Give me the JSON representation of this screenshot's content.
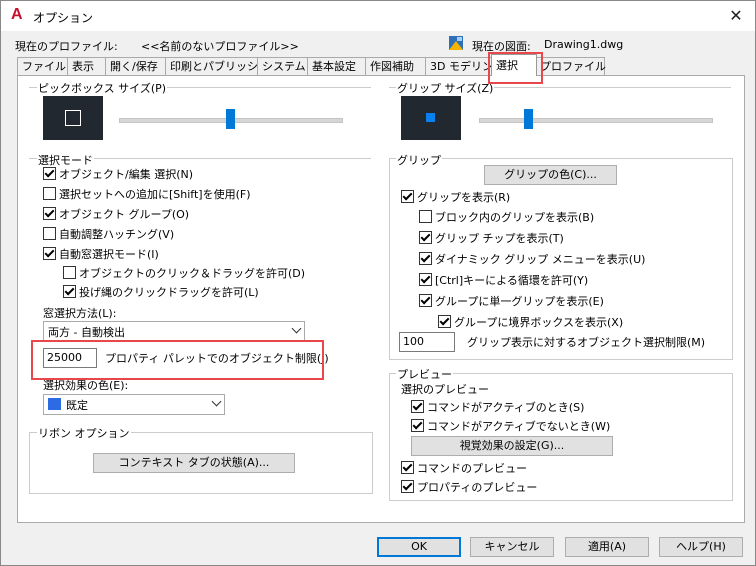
{
  "window": {
    "title": "オプション"
  },
  "profile": {
    "label": "現在のプロファイル:",
    "value": "<<名前のないプロファイル>>"
  },
  "drawing": {
    "label": "現在の図面:",
    "value": "Drawing1.dwg"
  },
  "tabs": [
    "ファイル",
    "表示",
    "開く/保存",
    "印刷とパブリッシュ",
    "システム",
    "基本設定",
    "作図補助",
    "3D モデリング",
    "選択",
    "プロファイル"
  ],
  "pickbox": {
    "title": "ピックボックス サイズ(P)",
    "level": 0.5
  },
  "gripsize": {
    "title": "グリップ サイズ(Z)",
    "level": 0.35
  },
  "selection_mode": {
    "title": "選択モード",
    "items": [
      {
        "label": "オブジェクト/編集 選択(N)",
        "checked": true
      },
      {
        "label": "選択セットへの追加に[Shift]を使用(F)",
        "checked": false
      },
      {
        "label": "オブジェクト グループ(O)",
        "checked": true
      },
      {
        "label": "自動調整ハッチング(V)",
        "checked": false
      },
      {
        "label": "自動窓選択モード(I)",
        "checked": true
      },
      {
        "label": "オブジェクトのクリック＆ドラッグを許可(D)",
        "checked": false
      },
      {
        "label": "投げ縄のクリックドラッグを許可(L)",
        "checked": true
      }
    ],
    "window_method_label": "窓選択方法(L):",
    "window_method_value": "両方 - 自動検出",
    "object_limit_value": "25000",
    "object_limit_label": "プロパティ パレットでのオブジェクト制限(J)",
    "effect_color_label": "選択効果の色(E):",
    "effect_color_value": "既定",
    "effect_color_swatch": "#2d6be5"
  },
  "ribbon": {
    "title": "リボン オプション",
    "button": "コンテキスト タブの状態(A)..."
  },
  "grips": {
    "title": "グリップ",
    "color_button": "グリップの色(C)...",
    "items": [
      {
        "label": "グリップを表示(R)",
        "checked": true
      },
      {
        "label": "ブロック内のグリップを表示(B)",
        "checked": false
      },
      {
        "label": "グリップ チップを表示(T)",
        "checked": true
      },
      {
        "label": "ダイナミック グリップ メニューを表示(U)",
        "checked": true
      },
      {
        "label": "[Ctrl]キーによる循環を許可(Y)",
        "checked": true
      },
      {
        "label": "グループに単一グリップを表示(E)",
        "checked": true
      },
      {
        "label": "グループに境界ボックスを表示(X)",
        "checked": true
      }
    ],
    "limit_value": "100",
    "limit_label": "グリップ表示に対するオブジェクト選択制限(M)"
  },
  "preview": {
    "title": "プレビュー",
    "selection_preview": "選択のプレビュー",
    "items": [
      {
        "label": "コマンドがアクティブのとき(S)",
        "checked": true
      },
      {
        "label": "コマンドがアクティブでないとき(W)",
        "checked": true
      }
    ],
    "visual_button": "視覚効果の設定(G)...",
    "items2": [
      {
        "label": "コマンドのプレビュー",
        "checked": true
      },
      {
        "label": "プロパティのプレビュー",
        "checked": true
      }
    ]
  },
  "buttons": {
    "ok": "OK",
    "cancel": "キャンセル",
    "apply": "適用(A)",
    "help": "ヘルプ(H)"
  },
  "close_icon": "✕"
}
